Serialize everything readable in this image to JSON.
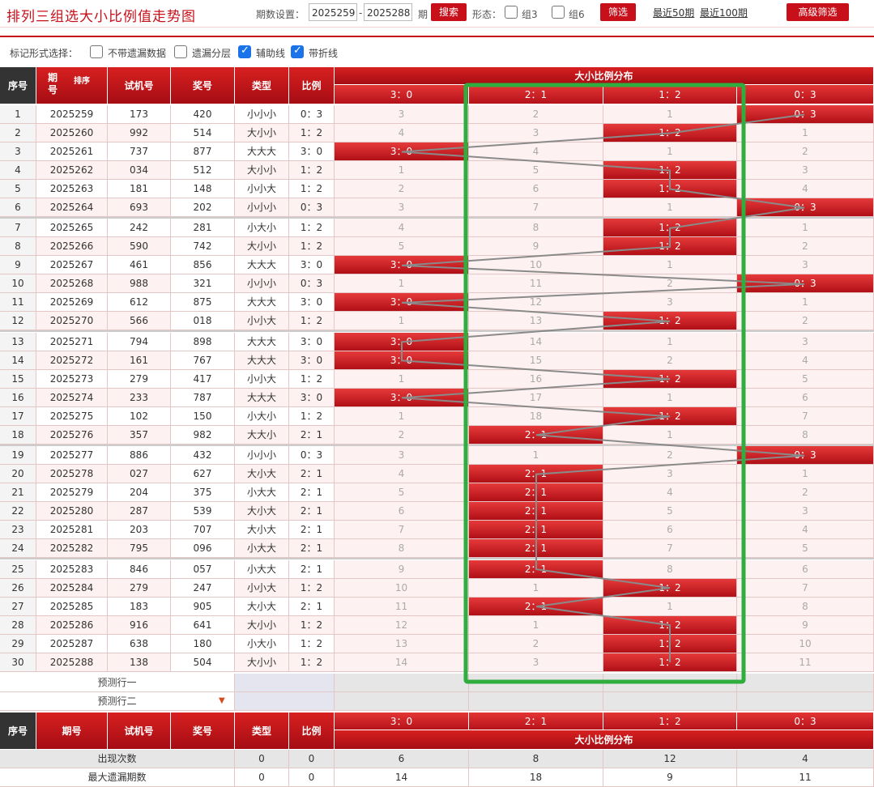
{
  "app_title": "排列三组选大小比例值走势图",
  "toolbar": {
    "period_label": "期数设置：",
    "from": "2025259",
    "dash": "-",
    "to": "2025288",
    "qi": "期",
    "search": "搜索",
    "form_label": "形态：",
    "zu3": "组3",
    "zu6": "组6",
    "filter": "筛选",
    "last50": "最近50期",
    "last100": "最近100期",
    "advanced": "高级筛选"
  },
  "mark": {
    "label": "标记形式选择：",
    "opt1": "不带遗漏数据",
    "opt2": "遗漏分层",
    "opt3": "辅助线",
    "opt4": "带折线"
  },
  "headers": {
    "seq": "序号",
    "period": "期号",
    "sort": "排序",
    "trial": "试机号",
    "prize": "奖号",
    "type": "类型",
    "ratio": "比例",
    "dist": "大小比例分布",
    "cols": [
      "3：0",
      "2：1",
      "1：2",
      "0：3"
    ]
  },
  "rows": [
    {
      "seq": "1",
      "period": "2025259",
      "trial": "173",
      "prize": "420",
      "type": "小小小",
      "ratio": "0：3",
      "hit": 3,
      "miss": [
        "3",
        "2",
        "1",
        ""
      ]
    },
    {
      "seq": "2",
      "period": "2025260",
      "trial": "992",
      "prize": "514",
      "type": "大小小",
      "ratio": "1：2",
      "hit": 2,
      "miss": [
        "4",
        "3",
        "",
        "1"
      ]
    },
    {
      "seq": "3",
      "period": "2025261",
      "trial": "737",
      "prize": "877",
      "type": "大大大",
      "ratio": "3：0",
      "hit": 0,
      "miss": [
        "",
        "4",
        "1",
        "2"
      ]
    },
    {
      "seq": "4",
      "period": "2025262",
      "trial": "034",
      "prize": "512",
      "type": "大小小",
      "ratio": "1：2",
      "hit": 2,
      "miss": [
        "1",
        "5",
        "",
        "3"
      ]
    },
    {
      "seq": "5",
      "period": "2025263",
      "trial": "181",
      "prize": "148",
      "type": "小小大",
      "ratio": "1：2",
      "hit": 2,
      "miss": [
        "2",
        "6",
        "",
        "4"
      ]
    },
    {
      "seq": "6",
      "period": "2025264",
      "trial": "693",
      "prize": "202",
      "type": "小小小",
      "ratio": "0：3",
      "hit": 3,
      "miss": [
        "3",
        "7",
        "1",
        ""
      ]
    },
    {
      "seq": "7",
      "period": "2025265",
      "trial": "242",
      "prize": "281",
      "type": "小大小",
      "ratio": "1：2",
      "hit": 2,
      "miss": [
        "4",
        "8",
        "",
        "1"
      ]
    },
    {
      "seq": "8",
      "period": "2025266",
      "trial": "590",
      "prize": "742",
      "type": "大小小",
      "ratio": "1：2",
      "hit": 2,
      "miss": [
        "5",
        "9",
        "",
        "2"
      ]
    },
    {
      "seq": "9",
      "period": "2025267",
      "trial": "461",
      "prize": "856",
      "type": "大大大",
      "ratio": "3：0",
      "hit": 0,
      "miss": [
        "",
        "10",
        "1",
        "3"
      ]
    },
    {
      "seq": "10",
      "period": "2025268",
      "trial": "988",
      "prize": "321",
      "type": "小小小",
      "ratio": "0：3",
      "hit": 3,
      "miss": [
        "1",
        "11",
        "2",
        ""
      ]
    },
    {
      "seq": "11",
      "period": "2025269",
      "trial": "612",
      "prize": "875",
      "type": "大大大",
      "ratio": "3：0",
      "hit": 0,
      "miss": [
        "",
        "12",
        "3",
        "1"
      ]
    },
    {
      "seq": "12",
      "period": "2025270",
      "trial": "566",
      "prize": "018",
      "type": "小小大",
      "ratio": "1：2",
      "hit": 2,
      "miss": [
        "1",
        "13",
        "",
        "2"
      ]
    },
    {
      "seq": "13",
      "period": "2025271",
      "trial": "794",
      "prize": "898",
      "type": "大大大",
      "ratio": "3：0",
      "hit": 0,
      "miss": [
        "",
        "14",
        "1",
        "3"
      ]
    },
    {
      "seq": "14",
      "period": "2025272",
      "trial": "161",
      "prize": "767",
      "type": "大大大",
      "ratio": "3：0",
      "hit": 0,
      "miss": [
        "",
        "15",
        "2",
        "4"
      ]
    },
    {
      "seq": "15",
      "period": "2025273",
      "trial": "279",
      "prize": "417",
      "type": "小小大",
      "ratio": "1：2",
      "hit": 2,
      "miss": [
        "1",
        "16",
        "",
        "5"
      ]
    },
    {
      "seq": "16",
      "period": "2025274",
      "trial": "233",
      "prize": "787",
      "type": "大大大",
      "ratio": "3：0",
      "hit": 0,
      "miss": [
        "",
        "17",
        "1",
        "6"
      ]
    },
    {
      "seq": "17",
      "period": "2025275",
      "trial": "102",
      "prize": "150",
      "type": "小大小",
      "ratio": "1：2",
      "hit": 2,
      "miss": [
        "1",
        "18",
        "",
        "7"
      ]
    },
    {
      "seq": "18",
      "period": "2025276",
      "trial": "357",
      "prize": "982",
      "type": "大大小",
      "ratio": "2：1",
      "hit": 1,
      "miss": [
        "2",
        "",
        "1",
        "8"
      ]
    },
    {
      "seq": "19",
      "period": "2025277",
      "trial": "886",
      "prize": "432",
      "type": "小小小",
      "ratio": "0：3",
      "hit": 3,
      "miss": [
        "3",
        "1",
        "2",
        ""
      ]
    },
    {
      "seq": "20",
      "period": "2025278",
      "trial": "027",
      "prize": "627",
      "type": "大小大",
      "ratio": "2：1",
      "hit": 1,
      "miss": [
        "4",
        "",
        "3",
        "1"
      ]
    },
    {
      "seq": "21",
      "period": "2025279",
      "trial": "204",
      "prize": "375",
      "type": "小大大",
      "ratio": "2：1",
      "hit": 1,
      "miss": [
        "5",
        "",
        "4",
        "2"
      ]
    },
    {
      "seq": "22",
      "period": "2025280",
      "trial": "287",
      "prize": "539",
      "type": "大小大",
      "ratio": "2：1",
      "hit": 1,
      "miss": [
        "6",
        "",
        "5",
        "3"
      ]
    },
    {
      "seq": "23",
      "period": "2025281",
      "trial": "203",
      "prize": "707",
      "type": "大小大",
      "ratio": "2：1",
      "hit": 1,
      "miss": [
        "7",
        "",
        "6",
        "4"
      ]
    },
    {
      "seq": "24",
      "period": "2025282",
      "trial": "795",
      "prize": "096",
      "type": "小大大",
      "ratio": "2：1",
      "hit": 1,
      "miss": [
        "8",
        "",
        "7",
        "5"
      ]
    },
    {
      "seq": "25",
      "period": "2025283",
      "trial": "846",
      "prize": "057",
      "type": "小大大",
      "ratio": "2：1",
      "hit": 1,
      "miss": [
        "9",
        "",
        "8",
        "6"
      ]
    },
    {
      "seq": "26",
      "period": "2025284",
      "trial": "279",
      "prize": "247",
      "type": "小小大",
      "ratio": "1：2",
      "hit": 2,
      "miss": [
        "10",
        "1",
        "",
        "7"
      ]
    },
    {
      "seq": "27",
      "period": "2025285",
      "trial": "183",
      "prize": "905",
      "type": "大小大",
      "ratio": "2：1",
      "hit": 1,
      "miss": [
        "11",
        "",
        "1",
        "8"
      ]
    },
    {
      "seq": "28",
      "period": "2025286",
      "trial": "916",
      "prize": "641",
      "type": "大小小",
      "ratio": "1：2",
      "hit": 2,
      "miss": [
        "12",
        "1",
        "",
        "9"
      ]
    },
    {
      "seq": "29",
      "period": "2025287",
      "trial": "638",
      "prize": "180",
      "type": "小大小",
      "ratio": "1：2",
      "hit": 2,
      "miss": [
        "13",
        "2",
        "",
        "10"
      ]
    },
    {
      "seq": "30",
      "period": "2025288",
      "trial": "138",
      "prize": "504",
      "type": "大小小",
      "ratio": "1：2",
      "hit": 2,
      "miss": [
        "14",
        "3",
        "",
        "11"
      ]
    }
  ],
  "predict": [
    "预测行一",
    "预测行二"
  ],
  "stats": {
    "label1": "出现次数",
    "row1": [
      "0",
      "0",
      "6",
      "8",
      "12",
      "4"
    ],
    "label2": "最大遗漏期数",
    "row2": [
      "0",
      "0",
      "14",
      "18",
      "9",
      "11"
    ]
  },
  "colors": {
    "accent": "#c8101a",
    "highlight_box": "#2fad3f"
  }
}
